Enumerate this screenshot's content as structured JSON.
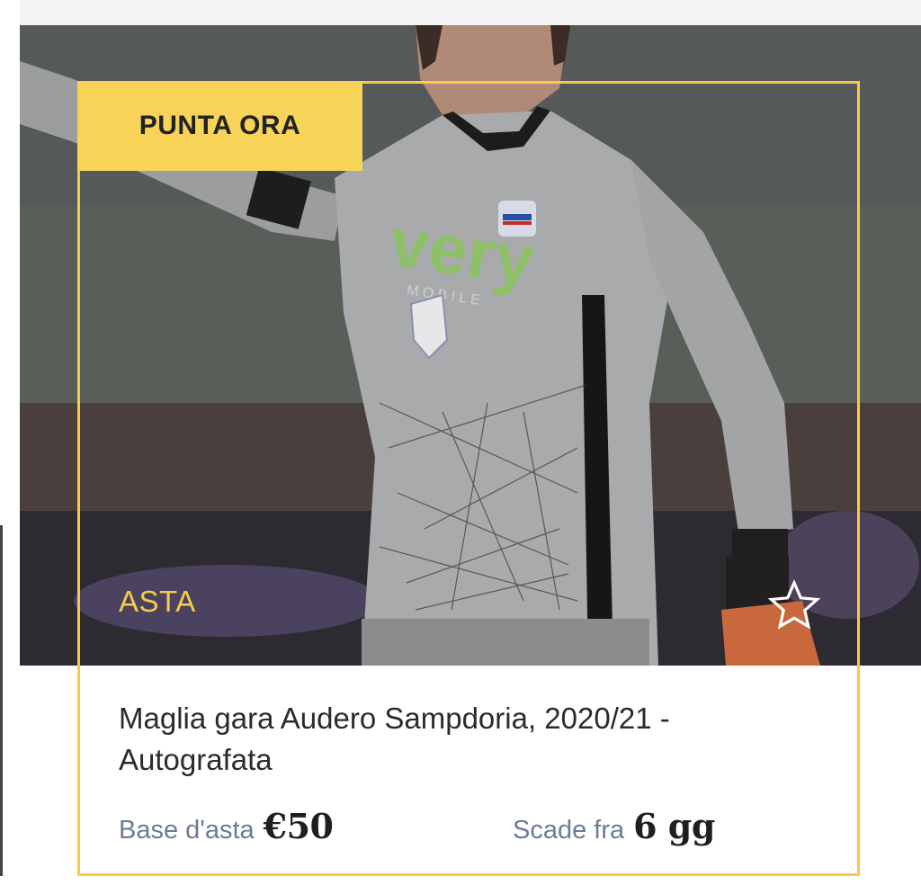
{
  "card": {
    "cta_label": "PUNTA ORA",
    "category_label": "ASTA",
    "favorite_icon": "star-outline-icon",
    "title": "Maglia gara Audero Sampdoria, 2020/21 - Autografata",
    "base_label": "Base d'asta",
    "base_value": "€50",
    "expiry_label": "Scade fra",
    "expiry_value": "6 gg"
  },
  "colors": {
    "accent": "#f4cc4a",
    "cta_background": "#f7d358",
    "label_color": "#6b7c96"
  }
}
